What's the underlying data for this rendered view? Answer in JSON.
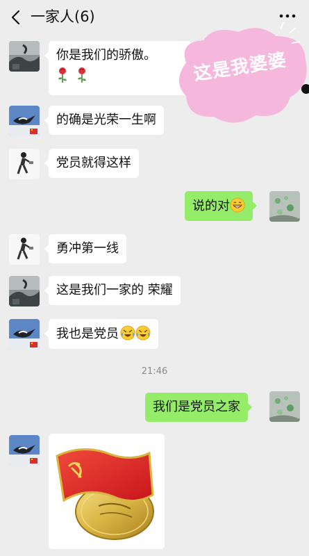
{
  "header": {
    "title": "一家人(6)",
    "back_icon": "chevron-left-icon",
    "more_icon": "more-dots-icon"
  },
  "messages": [
    {
      "side": "left",
      "sender_avatar": "landscape-avatar",
      "text": "你是我们的骄傲。",
      "extra": "rose rose"
    },
    {
      "side": "left",
      "sender_avatar": "bird-flag-avatar",
      "text": "的确是光荣一生啊"
    },
    {
      "side": "left",
      "sender_avatar": "runner-avatar",
      "text": "党员就得这样"
    },
    {
      "side": "right",
      "sender_avatar": "green-dots-avatar",
      "text": "说的对",
      "emoji": "grinning-face"
    },
    {
      "side": "left",
      "sender_avatar": "runner-avatar",
      "text": "勇冲第一线"
    },
    {
      "side": "left",
      "sender_avatar": "landscape-avatar",
      "text": "这是我们一家的 荣耀"
    },
    {
      "side": "left",
      "sender_avatar": "bird-flag-avatar",
      "text": "我也是党员",
      "emoji": "rolling-laughing x2"
    },
    {
      "side": "center",
      "type": "timestamp",
      "text": "21:46"
    },
    {
      "side": "right",
      "sender_avatar": "green-dots-avatar",
      "text": "我们是党员之家"
    },
    {
      "side": "left",
      "sender_avatar": "bird-flag-avatar",
      "type": "sticker",
      "sticker": "youth-league-badge"
    }
  ],
  "overlay": {
    "text": "这是我婆婆",
    "color": "#f5b8dc"
  },
  "colors": {
    "background": "#ededed",
    "bubble_left": "#ffffff",
    "bubble_right": "#95ec69",
    "timestamp": "#8a8a8a"
  }
}
